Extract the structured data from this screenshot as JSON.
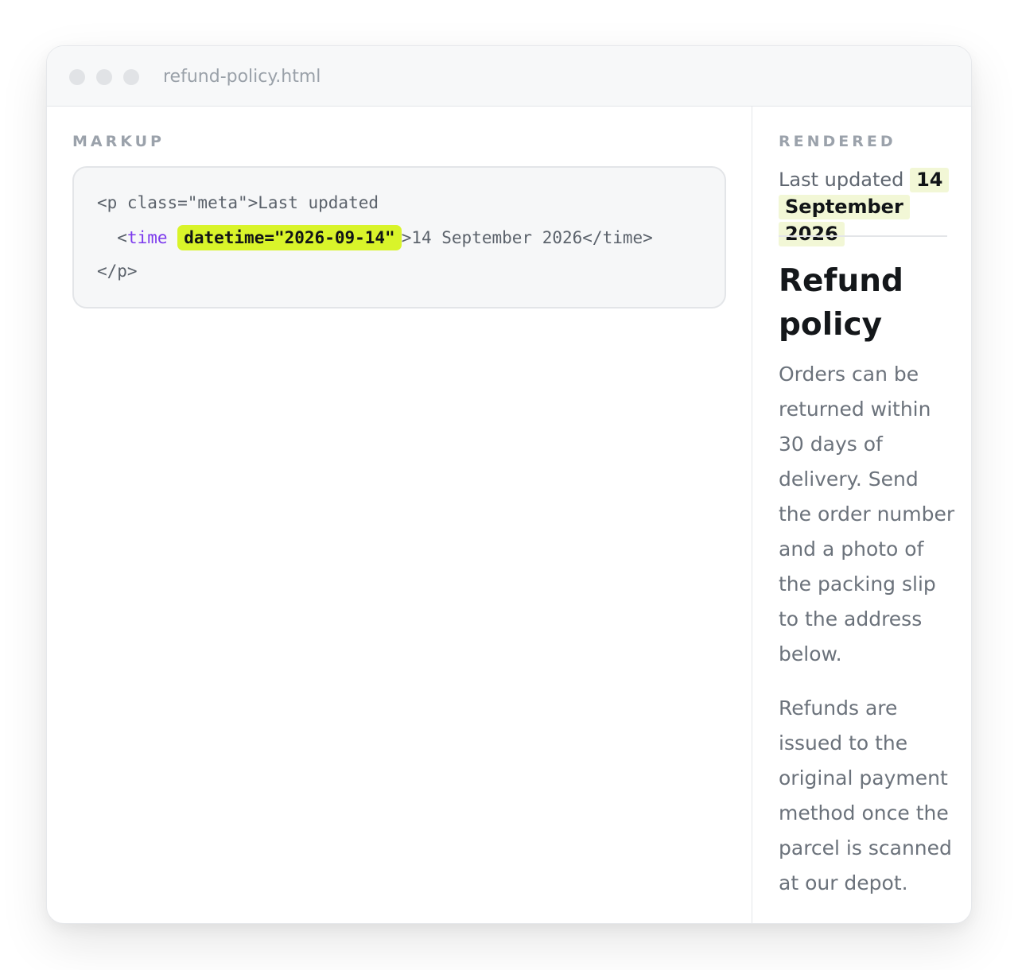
{
  "window": {
    "filename": "refund-policy.html"
  },
  "markup": {
    "label": "MARKUP",
    "line1": "<p class=\"meta\">Last updated",
    "line2_open": "<",
    "line2_tag": "time",
    "line2_attr": "datetime=\"2026-09-14\"",
    "line2_rest": ">14 September 2026</time>",
    "line3": "</p>",
    "highlight_color": "#d9f42a",
    "tag_color": "#7c3aed"
  },
  "rendered": {
    "label": "RENDERED",
    "meta_prefix": "Last updated",
    "meta_date": "14 September 2026",
    "title": "Refund policy",
    "paragraph1": "Orders can be returned within 30 days of delivery. Send the order number and a photo of the packing slip to the address below.",
    "paragraph2": "Refunds are issued to the original payment method once the parcel is scanned at our depot."
  }
}
